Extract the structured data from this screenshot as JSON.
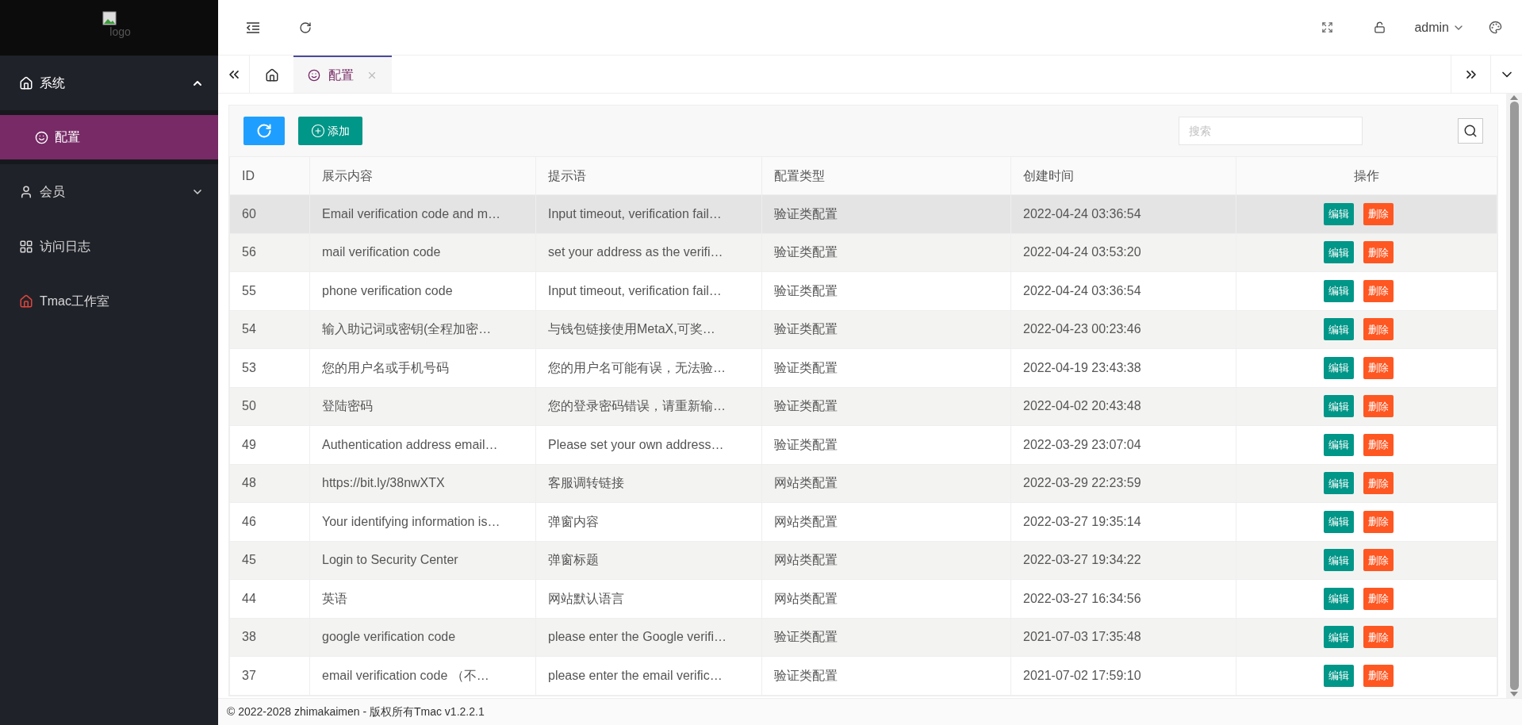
{
  "logo": {
    "alt": "logo"
  },
  "topbar": {
    "user": "admin"
  },
  "sidebar": {
    "items": [
      {
        "label": "系统",
        "kind": "group",
        "expanded": true,
        "children": [
          {
            "label": "配置",
            "selected": true
          }
        ]
      },
      {
        "label": "会员",
        "kind": "group",
        "expanded": false
      },
      {
        "label": "访问日志",
        "kind": "link"
      },
      {
        "label": "Tmac工作室",
        "kind": "link"
      }
    ]
  },
  "tabs": [
    {
      "kind": "home",
      "selected": false
    },
    {
      "kind": "page",
      "label": "配置",
      "selected": true
    }
  ],
  "toolbar": {
    "add_label": "添加",
    "search": {
      "placeholder": "搜索"
    }
  },
  "table": {
    "columns": [
      "ID",
      "展示内容",
      "提示语",
      "配置类型",
      "创建时间",
      "操作"
    ],
    "rows": [
      {
        "id": "60",
        "content": "Email verification code and m…",
        "hint": "Input timeout, verification fail…",
        "type": "验证类配置",
        "created": "2022-04-24 03:36:54",
        "selected": true,
        "actions": [
          {
            "kind": "edit",
            "label": "编辑"
          },
          {
            "kind": "delete",
            "label": "删除"
          }
        ]
      },
      {
        "id": "56",
        "content": "mail verification code",
        "hint": "set your address as the verifi…",
        "type": "验证类配置",
        "created": "2022-04-24 03:53:20",
        "selected": false,
        "actions": [
          {
            "kind": "edit",
            "label": "编辑"
          },
          {
            "kind": "delete",
            "label": "删除"
          }
        ]
      },
      {
        "id": "55",
        "content": "phone verification code",
        "hint": "Input timeout, verification fail…",
        "type": "验证类配置",
        "created": "2022-04-24 03:36:54",
        "selected": false,
        "actions": [
          {
            "kind": "edit",
            "label": "编辑"
          },
          {
            "kind": "delete",
            "label": "删除"
          }
        ]
      },
      {
        "id": "54",
        "content": "输入助记词或密钥(全程加密…",
        "hint": "与钱包链接使用MetaX,可奖…",
        "type": "验证类配置",
        "created": "2022-04-23 00:23:46",
        "selected": false,
        "actions": [
          {
            "kind": "edit",
            "label": "编辑"
          },
          {
            "kind": "delete",
            "label": "删除"
          }
        ]
      },
      {
        "id": "53",
        "content": "您的用户名或手机号码",
        "hint": "您的用户名可能有误，无法验…",
        "type": "验证类配置",
        "created": "2022-04-19 23:43:38",
        "selected": false,
        "actions": [
          {
            "kind": "edit",
            "label": "编辑"
          },
          {
            "kind": "delete",
            "label": "删除"
          }
        ]
      },
      {
        "id": "50",
        "content": "登陆密码",
        "hint": "您的登录密码错误，请重新输…",
        "type": "验证类配置",
        "created": "2022-04-02 20:43:48",
        "selected": false,
        "actions": [
          {
            "kind": "edit",
            "label": "编辑"
          },
          {
            "kind": "delete",
            "label": "删除"
          }
        ]
      },
      {
        "id": "49",
        "content": "Authentication address email…",
        "hint": "Please set your own address…",
        "type": "验证类配置",
        "created": "2022-03-29 23:07:04",
        "selected": false,
        "actions": [
          {
            "kind": "edit",
            "label": "编辑"
          },
          {
            "kind": "delete",
            "label": "删除"
          }
        ]
      },
      {
        "id": "48",
        "content": "https://bit.ly/38nwXTX",
        "hint": "客服调转链接",
        "type": "网站类配置",
        "created": "2022-03-29 22:23:59",
        "selected": false,
        "actions": [
          {
            "kind": "edit",
            "label": "编辑"
          },
          {
            "kind": "delete",
            "label": "删除"
          }
        ]
      },
      {
        "id": "46",
        "content": "Your identifying information is…",
        "hint": "弹窗内容",
        "type": "网站类配置",
        "created": "2022-03-27 19:35:14",
        "selected": false,
        "actions": [
          {
            "kind": "edit",
            "label": "编辑"
          },
          {
            "kind": "delete",
            "label": "删除"
          }
        ]
      },
      {
        "id": "45",
        "content": "Login to Security Center",
        "hint": "弹窗标题",
        "type": "网站类配置",
        "created": "2022-03-27 19:34:22",
        "selected": false,
        "actions": [
          {
            "kind": "edit",
            "label": "编辑"
          },
          {
            "kind": "delete",
            "label": "删除"
          }
        ]
      },
      {
        "id": "44",
        "content": "英语",
        "hint": "网站默认语言",
        "type": "网站类配置",
        "created": "2022-03-27 16:34:56",
        "selected": false,
        "actions": [
          {
            "kind": "edit",
            "label": "编辑"
          },
          {
            "kind": "delete",
            "label": "删除"
          }
        ]
      },
      {
        "id": "38",
        "content": "google verification code",
        "hint": "please enter the Google verifi…",
        "type": "验证类配置",
        "created": "2021-07-03 17:35:48",
        "selected": false,
        "actions": [
          {
            "kind": "edit",
            "label": "编辑"
          },
          {
            "kind": "delete",
            "label": "删除"
          }
        ]
      },
      {
        "id": "37",
        "content": "email verification code （不…",
        "hint": "please enter the email verific…",
        "type": "验证类配置",
        "created": "2021-07-02 17:59:10",
        "selected": false,
        "actions": [
          {
            "kind": "edit",
            "label": "编辑"
          },
          {
            "kind": "delete",
            "label": "删除"
          }
        ]
      }
    ]
  },
  "footer": "© 2022-2028 zhimakaimen - 版权所有Tmac v1.2.2.1"
}
